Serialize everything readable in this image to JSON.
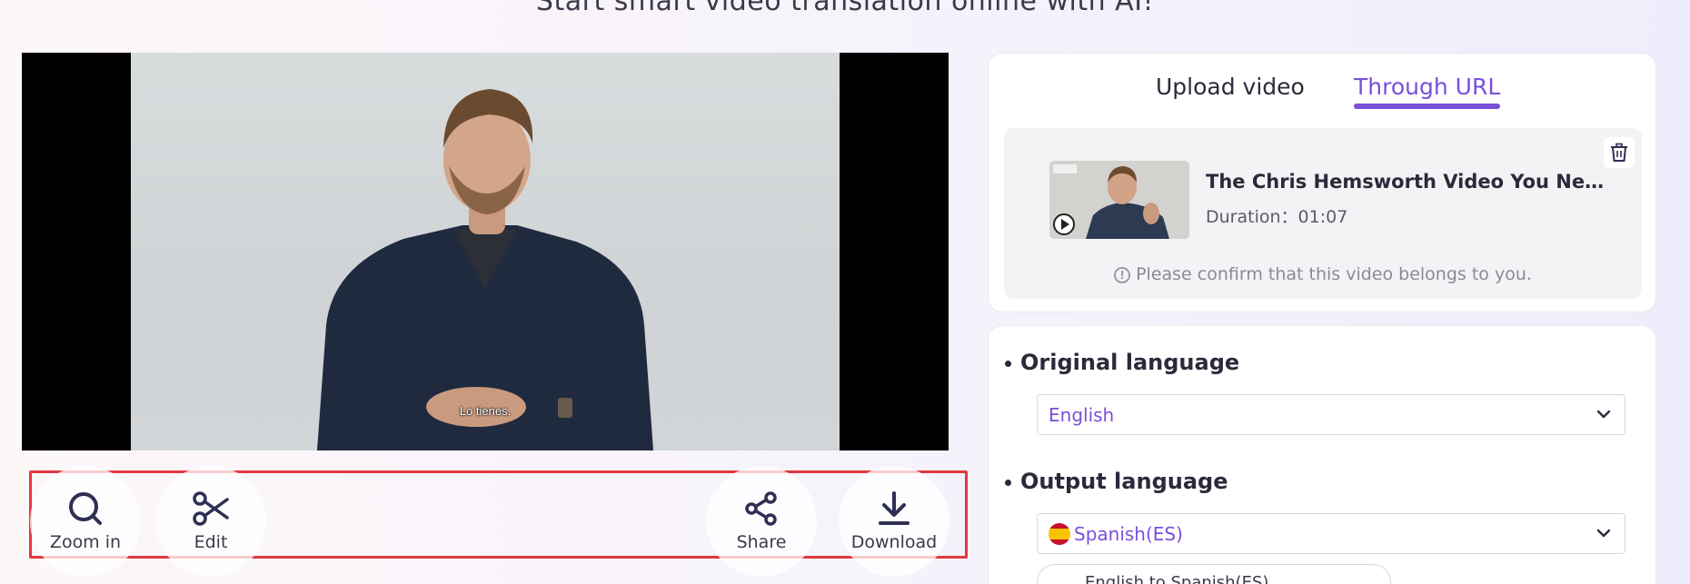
{
  "page": {
    "headline": "Start smart video translation online with AI!"
  },
  "player": {
    "subtitle": "Lo tienes."
  },
  "toolbar": {
    "zoom_label": "Zoom in",
    "edit_label": "Edit",
    "share_label": "Share",
    "download_label": "Download",
    "highlight_color": "#e0393e"
  },
  "upload": {
    "tabs": [
      {
        "label": "Upload video",
        "active": false
      },
      {
        "label": "Through URL",
        "active": true
      }
    ],
    "accent_color": "#7a4fdb",
    "video": {
      "title": "The Chris Hemsworth Video You Need | ...",
      "duration": "Duration：01:07"
    },
    "confirm_text": "Please confirm that this video belongs to you."
  },
  "settings": {
    "original_language": {
      "label": "Original language",
      "value": "English"
    },
    "output_language": {
      "label": "Output language",
      "value": "Spanish(ES)"
    },
    "selected_pair": "English to Spanish(ES)"
  }
}
